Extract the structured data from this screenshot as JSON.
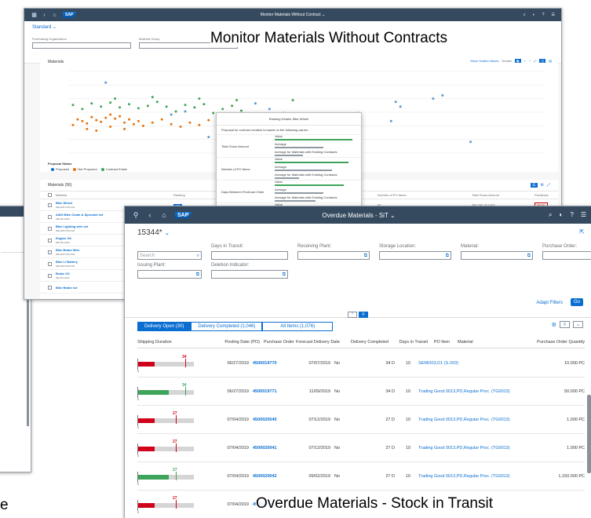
{
  "captions": {
    "monitor": "Monitor Materials Without Contracts",
    "overdue": "Overdue Materials - Stock in Transit",
    "left_fragment": "e"
  },
  "colors": {
    "shell": "#354a5f",
    "accent": "#0a6ed1",
    "overdue": "#d0021b",
    "ontime": "#3fa45b"
  },
  "win1": {
    "title": "Monitor Materials Without Contract",
    "variant": "Standard",
    "filters": [
      {
        "label": "Purchasing Organization"
      },
      {
        "label": "Material Group"
      }
    ],
    "chart": {
      "title": "Materials",
      "tools": {
        "scaled": "Show Scaled Values",
        "details": "Details"
      }
    },
    "legend": {
      "title": "Proposal Status",
      "items": [
        {
          "label": "Proposed",
          "color": "#0a6ed1"
        },
        {
          "label": "Not Proposed",
          "color": "#e9730c"
        },
        {
          "label": "Contract Exists",
          "color": "#3fa45b"
        }
      ]
    },
    "table": {
      "title": "Materials (56)",
      "header": {
        "material": "Material",
        "ranking": "Ranking",
        "po_items": "Number of PO Items",
        "gross": "Total Gross Amount",
        "feedback": "Feedback"
      },
      "rows": [
        {
          "name": "Bike Wheel",
          "id": "ME-MATCON-001",
          "ranking": "100",
          "po_items": "87",
          "gross": "350,234.47 USD",
          "feedback": "Dismiss"
        },
        {
          "name": "A300 Bike Chain & Sprocket set",
          "id": "ME-PR-A200",
          "ranking": "90",
          "po_items": "82",
          "gross": "350,189.00 USD",
          "feedback": "Dismiss"
        },
        {
          "name": "Bike Lighting wire set",
          "id": "ME-MATCON-002",
          "ranking": "",
          "po_items": "",
          "gross": "",
          "feedback": ""
        },
        {
          "name": "Engine Oil",
          "id": "ME-PR-A203",
          "ranking": "",
          "po_items": "",
          "gross": "",
          "feedback": ""
        },
        {
          "name": "Bike Brake Wire",
          "id": "ME-MATCON-003",
          "ranking": "",
          "po_items": "",
          "gross": "",
          "feedback": ""
        },
        {
          "name": "Bike Li Battery",
          "id": "ME-MATCON-004",
          "ranking": "",
          "po_items": "",
          "gross": "",
          "feedback": ""
        },
        {
          "name": "Brake Oil",
          "id": "ME-PR-A202",
          "ranking": "",
          "po_items": "",
          "gross": "",
          "feedback": ""
        },
        {
          "name": "Bike Brake set",
          "id": "",
          "ranking": "",
          "po_items": "",
          "gross": "",
          "feedback": ""
        }
      ]
    },
    "popover": {
      "title": "Ranking Details: Bike Wheel",
      "note": "Proposal for contract creation is based on the following values:",
      "rows": [
        {
          "label": "Total Gross Amount",
          "value": "Value",
          "average": "Average",
          "avg_existing": "Average for Materials with Existing Contracts"
        },
        {
          "label": "Number of PO Items",
          "value": "Value",
          "average": "Average",
          "avg_existing": "Average for Materials with Existing Contracts"
        },
        {
          "label": "Days Between First/Last Order",
          "value": "Value",
          "average": "Average",
          "avg_existing": "Average for Materials with Existing Contracts"
        },
        {
          "label": "Number of Suppliers",
          "value": "Value",
          "average": "Average",
          "avg_existing": "Average for Materials with Existing Contracts"
        }
      ]
    }
  },
  "win3": {
    "title": "Overdue Materials - SiT",
    "variant": "15344*",
    "filters": [
      {
        "label": "",
        "placeholder": "Search"
      },
      {
        "label": "Days in Transit:",
        "placeholder": ""
      },
      {
        "label": "Receiving Plant:",
        "placeholder": ""
      },
      {
        "label": "Storage Location:",
        "placeholder": ""
      },
      {
        "label": "Material:",
        "placeholder": ""
      },
      {
        "label": "Purchase Order:",
        "placeholder": ""
      }
    ],
    "filters2": [
      {
        "label": "Issuing Plant:"
      },
      {
        "label": "Deletion Indicator:"
      }
    ],
    "adapt": "Adapt Filters",
    "go": "Go",
    "tabs": [
      {
        "label": "Delivery Open (30)",
        "active": true
      },
      {
        "label": "Delivery Completed (1,046)",
        "active": false
      },
      {
        "label": "All Items (1,076)",
        "active": false
      }
    ],
    "columns": {
      "sd": "Shipping Duration",
      "pd": "Posting Date (PO)",
      "po": "Purchase Order",
      "fd": "Forecast Delivery Date",
      "dc": "Delivery Completed",
      "dt": "Days in Transit",
      "pi": "PO Item",
      "mat": "Material",
      "qty": "Purchase Order Quantity"
    },
    "rows": [
      {
        "bar": 34,
        "status": "overdue",
        "pd": "06/27/2019",
        "po": "4500019770",
        "fd": "07/07/2019",
        "dc": "No",
        "dt": "34 D",
        "pi": "10",
        "mat": "SEMI203,D1 (S-203)",
        "qty": "10.000  PC"
      },
      {
        "bar": 34,
        "status": "ontime",
        "pd": "06/27/2019",
        "po": "4500019771",
        "fd": "11/09/2019",
        "dc": "No",
        "dt": "34 D",
        "pi": "10",
        "mat": "Trading Good 0013,PD,Regular Proc. (TG0013)",
        "qty": "50.000  PC"
      },
      {
        "bar": 27,
        "status": "overdue",
        "pd": "07/04/2019",
        "po": "4500020040",
        "fd": "07/12/2019",
        "dc": "No",
        "dt": "27 D",
        "pi": "10",
        "mat": "Trading Good 0013,PD,Regular Proc. (TG0013)",
        "qty": "1.000  PC"
      },
      {
        "bar": 27,
        "status": "overdue",
        "pd": "07/04/2019",
        "po": "4500020041",
        "fd": "07/12/2019",
        "dc": "No",
        "dt": "27 D",
        "pi": "10",
        "mat": "Trading Good 0013,PD,Regular Proc. (TG0013)",
        "qty": "1.000  PC"
      },
      {
        "bar": 27,
        "status": "ontime",
        "pd": "07/04/2019",
        "po": "4500020042",
        "fd": "09/02/2019",
        "dc": "No",
        "dt": "27 D",
        "pi": "10",
        "mat": "Trading Good 0013,PD,Regular Proc. (TG0013)",
        "qty": "1,150.000  PC"
      },
      {
        "bar": 27,
        "status": "overdue",
        "pd": "07/04/2019",
        "po": "4500020",
        "fd": "",
        "dc": "",
        "dt": "",
        "pi": "",
        "mat": "",
        "qty": ""
      }
    ]
  },
  "scatter": {
    "proposed": [
      [
        30,
        20
      ],
      [
        8,
        88
      ],
      [
        40,
        62
      ],
      [
        22,
        48
      ],
      [
        43,
        55
      ],
      [
        46,
        50
      ],
      [
        44,
        40
      ],
      [
        39,
        25
      ],
      [
        32,
        18
      ],
      [
        51,
        14
      ],
      [
        25,
        52
      ],
      [
        40,
        33
      ],
      [
        62,
        50
      ],
      [
        71,
        58
      ],
      [
        70,
        64
      ],
      [
        78,
        68
      ],
      [
        80,
        72
      ],
      [
        69,
        40
      ],
      [
        86,
        14
      ],
      [
        60,
        36
      ]
    ],
    "not_proposed": [
      [
        1,
        35
      ],
      [
        2,
        42
      ],
      [
        3,
        40
      ],
      [
        4,
        37
      ],
      [
        5,
        45
      ],
      [
        6,
        41
      ],
      [
        7,
        39
      ],
      [
        8,
        44
      ],
      [
        9,
        48
      ],
      [
        10,
        43
      ],
      [
        11,
        46
      ],
      [
        12,
        38
      ],
      [
        13,
        42
      ],
      [
        14,
        36
      ],
      [
        15,
        40
      ],
      [
        4,
        30
      ],
      [
        6,
        28
      ],
      [
        9,
        33
      ],
      [
        12,
        30
      ],
      [
        16,
        34
      ],
      [
        18,
        38
      ],
      [
        20,
        42
      ],
      [
        22,
        36
      ],
      [
        24,
        33
      ],
      [
        26,
        38
      ],
      [
        28,
        35
      ],
      [
        30,
        41
      ],
      [
        34,
        37
      ],
      [
        36,
        33
      ],
      [
        38,
        30
      ]
    ],
    "contract": [
      [
        1,
        60
      ],
      [
        3,
        55
      ],
      [
        5,
        62
      ],
      [
        7,
        58
      ],
      [
        9,
        63
      ],
      [
        11,
        57
      ],
      [
        13,
        61
      ],
      [
        15,
        56
      ],
      [
        17,
        59
      ],
      [
        19,
        64
      ],
      [
        21,
        58
      ],
      [
        23,
        52
      ],
      [
        25,
        60
      ],
      [
        27,
        57
      ],
      [
        29,
        61
      ],
      [
        31,
        50
      ],
      [
        33,
        55
      ],
      [
        35,
        59
      ],
      [
        37,
        53
      ],
      [
        36,
        66
      ],
      [
        28,
        68
      ],
      [
        18,
        70
      ],
      [
        10,
        68
      ],
      [
        48,
        66
      ]
    ]
  }
}
